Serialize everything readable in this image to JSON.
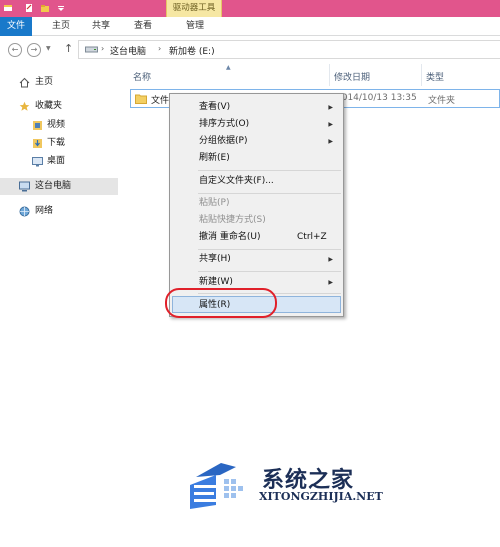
{
  "titlebar": {
    "context_tab_group": "驱动器工具"
  },
  "ribbon": {
    "tabs": [
      "文件",
      "主页",
      "共享",
      "查看",
      "管理"
    ]
  },
  "address": {
    "crumbs": [
      "这台电脑",
      "新加卷 (E:)"
    ]
  },
  "navpane": {
    "items": [
      "主页",
      "收藏夹",
      "视频",
      "下载",
      "桌面",
      "这台电脑",
      "网络"
    ]
  },
  "content": {
    "headers": [
      "名称",
      "修改日期",
      "类型"
    ],
    "file": {
      "name": "文件",
      "date": "2014/10/13 13:35",
      "type": "文件夹"
    }
  },
  "context_menu": {
    "items": [
      {
        "label": "查看(V)",
        "submenu": true
      },
      {
        "label": "排序方式(O)",
        "submenu": true
      },
      {
        "label": "分组依据(P)",
        "submenu": true
      },
      {
        "label": "刷新(E)"
      },
      {
        "label": "自定义文件夹(F)..."
      },
      {
        "label": "粘贴(P)",
        "disabled": true
      },
      {
        "label": "粘贴快捷方式(S)",
        "disabled": true
      },
      {
        "label": "撤消 重命名(U)",
        "shortcut": "Ctrl+Z"
      },
      {
        "label": "共享(H)",
        "submenu": true
      },
      {
        "label": "新建(W)",
        "submenu": true
      },
      {
        "label": "属性(R)"
      }
    ]
  },
  "watermark": {
    "title": "系统之家",
    "url": "XITONGZHIJIA.NET"
  },
  "colors": {
    "title_bar": "#e1558c",
    "file_tab": "#1979ca",
    "highlight": "#e0202a"
  }
}
